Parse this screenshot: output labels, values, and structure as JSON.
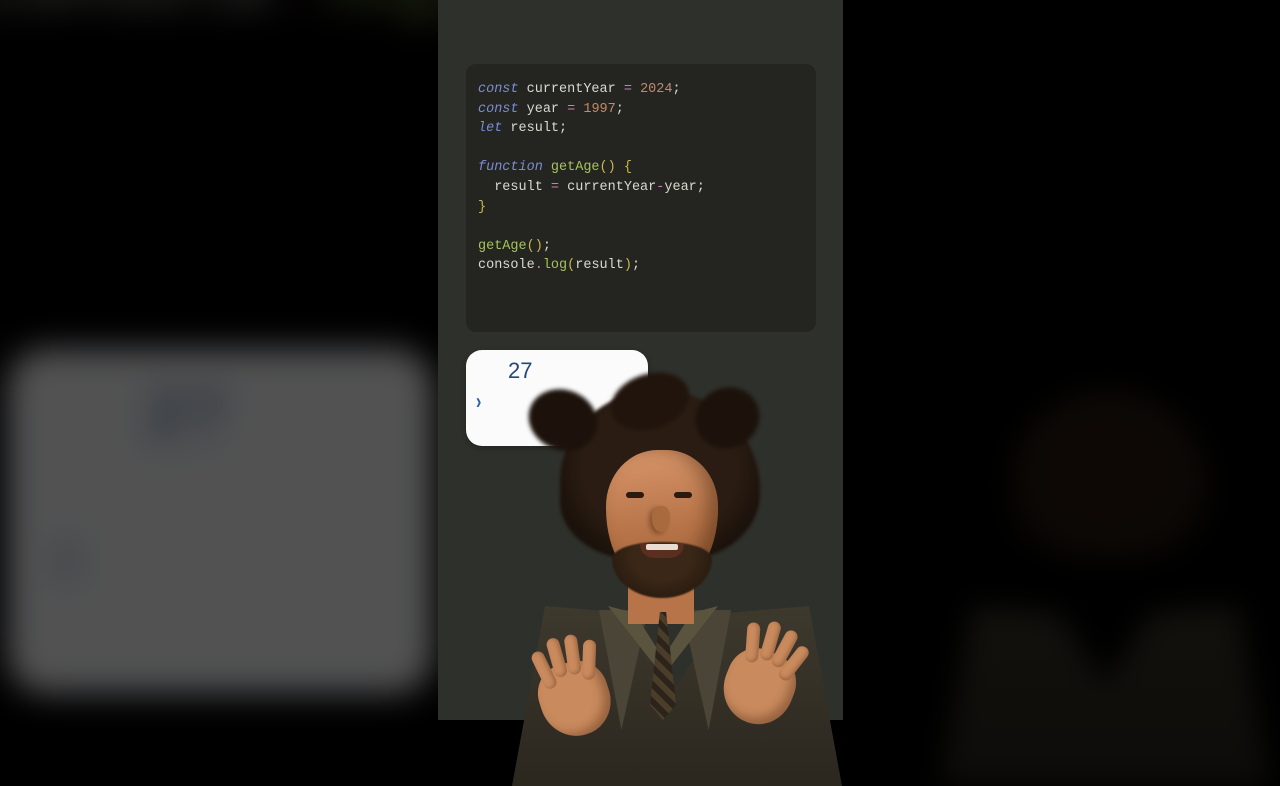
{
  "bg": {
    "line1_getAge": "getAge",
    "line1_parens": "();",
    "line2_console": "console",
    "line2_dot": ".",
    "line2_log": "log",
    "line2_open": "(",
    "output_value": "27",
    "output_prompt": "›"
  },
  "code": {
    "l1": {
      "kw": "const",
      "id": "currentYear",
      "eq": "=",
      "num": "2024",
      "semi": ";"
    },
    "l2": {
      "kw": "const",
      "id": "year",
      "eq": "=",
      "num": "1997",
      "semi": ";"
    },
    "l3": {
      "kw": "let",
      "id": "result",
      "semi": ";"
    },
    "l5": {
      "kw": "function",
      "name": "getAge",
      "parens": "()",
      "brace": "{"
    },
    "l6": {
      "indent": "  ",
      "id": "result",
      "eq": "=",
      "a": "currentYear",
      "op": "-",
      "b": "year",
      "semi": ";"
    },
    "l7": {
      "brace": "}"
    },
    "l9": {
      "name": "getAge",
      "parens": "()",
      "semi": ";"
    },
    "l10": {
      "obj": "console",
      "dot": ".",
      "method": "log",
      "open": "(",
      "arg": "result",
      "close": ")",
      "semi": ";"
    }
  },
  "output": {
    "value": "27",
    "prompt": "›"
  }
}
